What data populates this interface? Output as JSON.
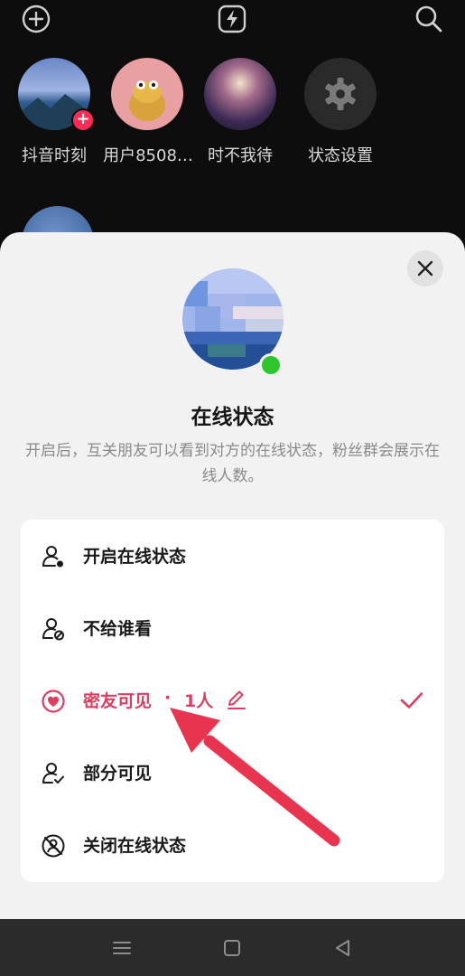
{
  "top_bar": {
    "add_icon": "plus-circle-icon",
    "flash_icon": "lightning-icon",
    "search_icon": "search-icon"
  },
  "contacts": [
    {
      "name": "抖音时刻"
    },
    {
      "name": "用户8508…"
    },
    {
      "name": "时不我待"
    },
    {
      "name": "状态设置"
    }
  ],
  "sheet": {
    "title": "在线状态",
    "description": "开启后，互关朋友可以看到对方的在线状态，粉丝群会展示在线人数。",
    "options": [
      {
        "label": "开启在线状态",
        "icon": "person-dot-icon"
      },
      {
        "label": "不给谁看",
        "icon": "person-blocked-icon"
      },
      {
        "label": "密友可见",
        "separator": "·",
        "count": "1人",
        "icon": "heart-circle-icon",
        "selected": true
      },
      {
        "label": "部分可见",
        "icon": "person-check-icon"
      },
      {
        "label": "关闭在线状态",
        "icon": "person-off-icon"
      }
    ]
  },
  "colors": {
    "accent": "#e03c5e",
    "online": "#2ec52e",
    "arrow": "#e8344f"
  }
}
